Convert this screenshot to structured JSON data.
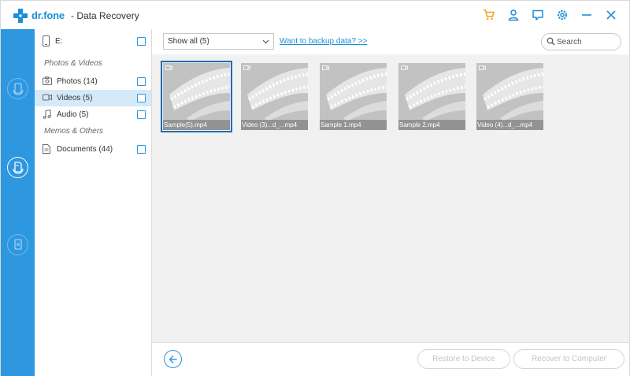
{
  "window": {
    "brand": "dr.fone",
    "title": "- Data Recovery"
  },
  "title_icons": [
    "cart-icon",
    "user-icon",
    "feedback-icon",
    "settings-icon",
    "minimize-icon",
    "close-icon"
  ],
  "colors": {
    "rail": "#2d97e0",
    "accent": "#1e8fd6",
    "selected_row": "#d5e9f8",
    "cart": "#f0a21b"
  },
  "sidebar": {
    "drive_label": "E:",
    "section_media": "Photos & Videos",
    "section_other": "Memos & Others",
    "items": [
      {
        "label": "Photos (14)",
        "icon": "photo-icon"
      },
      {
        "label": "Videos (5)",
        "icon": "video-icon"
      },
      {
        "label": "Audio (5)",
        "icon": "audio-icon"
      },
      {
        "label": "Documents (44)",
        "icon": "document-icon"
      }
    ]
  },
  "toolbar": {
    "filter_value": "Show all (5)",
    "backup_link": "Want to backup data? >>",
    "search_placeholder": "Search"
  },
  "thumbnails": [
    {
      "name": "Sample(5).mp4",
      "selected": true
    },
    {
      "name": "Video (3)...d_...mp4",
      "selected": false
    },
    {
      "name": "Sample 1.mp4",
      "selected": false
    },
    {
      "name": "Sample 2.mp4",
      "selected": false
    },
    {
      "name": "Video (4)...d_...mp4",
      "selected": false
    }
  ],
  "footer": {
    "restore_label": "Restore to Device",
    "recover_label": "Recover to Computer"
  }
}
